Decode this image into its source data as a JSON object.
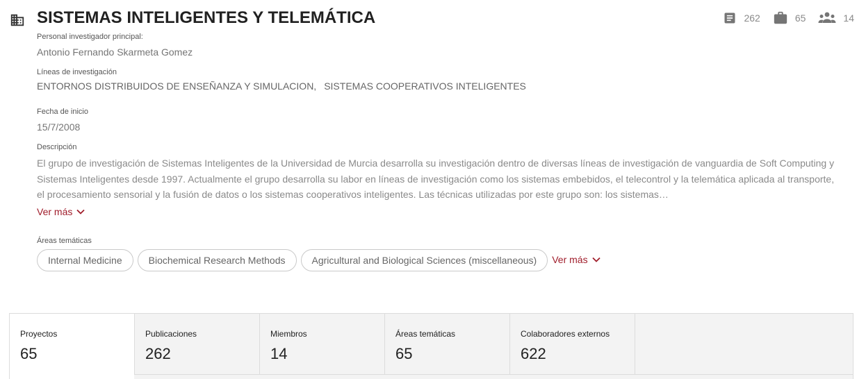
{
  "group": {
    "title": "SISTEMAS INTELIGENTES Y TELEMÁTICA",
    "icon": "building-icon"
  },
  "stats": [
    {
      "icon": "document-icon",
      "value": "262"
    },
    {
      "icon": "briefcase-icon",
      "value": "65"
    },
    {
      "icon": "people-icon",
      "value": "14"
    }
  ],
  "pi": {
    "label": "Personal investigador principal:",
    "value": "Antonio Fernando Skarmeta Gomez"
  },
  "research_lines": {
    "label": "Líneas de investigación",
    "items": [
      "ENTORNOS DISTRIBUIDOS DE ENSEÑANZA Y SIMULACION,",
      "SISTEMAS COOPERATIVOS INTELIGENTES"
    ]
  },
  "start_date": {
    "label": "Fecha de inicio",
    "value": "15/7/2008"
  },
  "description": {
    "label": "Descripción",
    "text": "El grupo de investigación de Sistemas Inteligentes de la Universidad de Murcia desarrolla su investigación dentro de diversas líneas de investigación de vanguardia de Soft Computing y Sistemas Inteligentes desde 1997. Actualmente el grupo desarrolla su labor en líneas de investigación como los sistemas embebidos, el telecontrol y la telemática aplicada al transporte, el procesamiento sensorial y la fusión de datos o los sistemas cooperativos inteligentes. Las técnicas utilizadas por este grupo son: los sistemas…",
    "more_label": "Ver más"
  },
  "areas": {
    "label": "Áreas temáticas",
    "chips": [
      "Internal Medicine",
      "Biochemical Research Methods",
      "Agricultural and Biological Sciences (miscellaneous)"
    ],
    "more_label": "Ver más"
  },
  "tabs": [
    {
      "label": "Proyectos",
      "count": "65",
      "active": true
    },
    {
      "label": "Publicaciones",
      "count": "262",
      "active": false
    },
    {
      "label": "Miembros",
      "count": "14",
      "active": false
    },
    {
      "label": "Áreas temáticas",
      "count": "65",
      "active": false
    },
    {
      "label": "Colaboradores externos",
      "count": "622",
      "active": false
    }
  ],
  "colors": {
    "accent": "#a01d2b",
    "title": "#212121",
    "muted": "#8a8a8a",
    "tab_bg": "#f3f3f3"
  }
}
